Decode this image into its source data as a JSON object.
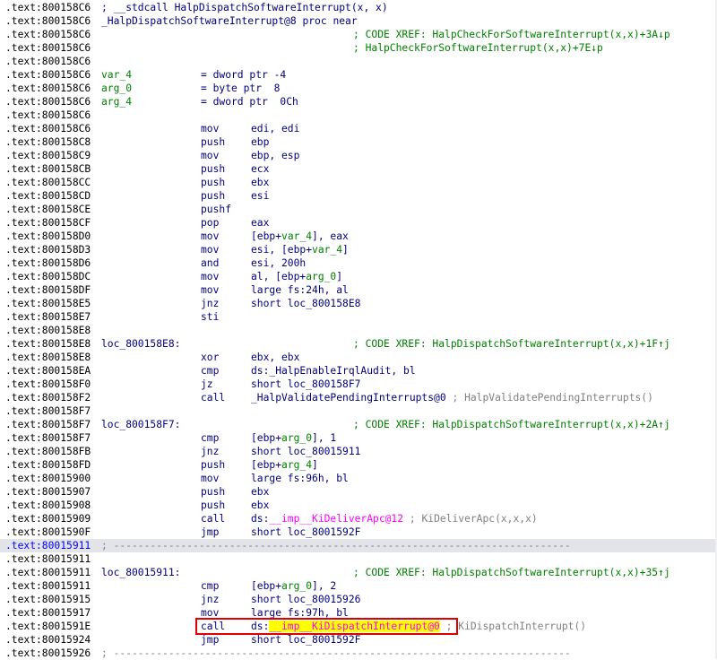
{
  "rows": [
    {
      "addr": ".text:800158C6",
      "hdr": "; __stdcall HalpDispatchSoftwareInterrupt(x, x)"
    },
    {
      "addr": ".text:800158C6",
      "hdr": "_HalpDispatchSoftwareInterrupt@8 proc near"
    },
    {
      "addr": ".text:800158C6",
      "xref": "; CODE XREF: HalpCheckForSoftwareInterrupt(x,x)+3A↓p"
    },
    {
      "addr": ".text:800158C6",
      "xref": "; HalpCheckForSoftwareInterrupt(x,x)+7E↓p"
    },
    {
      "addr": ".text:800158C6"
    },
    {
      "addr": ".text:800158C6",
      "var": "var_4",
      "def": "= dword ptr -4"
    },
    {
      "addr": ".text:800158C6",
      "var": "arg_0",
      "def": "= byte ptr  8"
    },
    {
      "addr": ".text:800158C6",
      "var": "arg_4",
      "def": "= dword ptr  0Ch"
    },
    {
      "addr": ".text:800158C6"
    },
    {
      "addr": ".text:800158C6",
      "mnem": "mov",
      "ops": "edi, edi"
    },
    {
      "addr": ".text:800158C8",
      "mnem": "push",
      "ops": "ebp"
    },
    {
      "addr": ".text:800158C9",
      "mnem": "mov",
      "ops": "ebp, esp"
    },
    {
      "addr": ".text:800158CB",
      "mnem": "push",
      "ops": "ecx"
    },
    {
      "addr": ".text:800158CC",
      "mnem": "push",
      "ops": "ebx"
    },
    {
      "addr": ".text:800158CD",
      "mnem": "push",
      "ops": "esi"
    },
    {
      "addr": ".text:800158CE",
      "mnem": "pushf"
    },
    {
      "addr": ".text:800158CF",
      "mnem": "pop",
      "ops": "eax"
    },
    {
      "addr": ".text:800158D0",
      "mnem": "mov",
      "ops_a": "[ebp+",
      "ops_v": "var_4",
      "ops_b": "], eax"
    },
    {
      "addr": ".text:800158D3",
      "mnem": "mov",
      "ops_a": "esi, [ebp+",
      "ops_v": "var_4",
      "ops_b": "]"
    },
    {
      "addr": ".text:800158D6",
      "mnem": "and",
      "ops": "esi, 200h"
    },
    {
      "addr": ".text:800158DC",
      "mnem": "mov",
      "ops_a": "al, [ebp+",
      "ops_v": "arg_0",
      "ops_b": "]"
    },
    {
      "addr": ".text:800158DF",
      "mnem": "mov",
      "ops": "large fs:24h, al"
    },
    {
      "addr": ".text:800158E5",
      "mnem": "jnz",
      "ops": "short loc_800158E8"
    },
    {
      "addr": ".text:800158E7",
      "mnem": "sti"
    },
    {
      "addr": ".text:800158E8"
    },
    {
      "addr": ".text:800158E8",
      "label": "loc_800158E8:",
      "xref": "; CODE XREF: HalpDispatchSoftwareInterrupt(x,x)+1F↑j"
    },
    {
      "addr": ".text:800158E8",
      "mnem": "xor",
      "ops": "ebx, ebx"
    },
    {
      "addr": ".text:800158EA",
      "mnem": "cmp",
      "ops": "ds:_HalpEnableIrqlAudit, bl"
    },
    {
      "addr": ".text:800158F0",
      "mnem": "jz",
      "ops": "short loc_800158F7"
    },
    {
      "addr": ".text:800158F2",
      "mnem": "call",
      "ops": "_HalpValidatePendingInterrupts@0",
      "cmt": "; HalpValidatePendingInterrupts()"
    },
    {
      "addr": ".text:800158F7"
    },
    {
      "addr": ".text:800158F7",
      "label": "loc_800158F7:",
      "xref": "; CODE XREF: HalpDispatchSoftwareInterrupt(x,x)+2A↑j"
    },
    {
      "addr": ".text:800158F7",
      "mnem": "cmp",
      "ops_a": "[ebp+",
      "ops_v": "arg_0",
      "ops_b": "], 1"
    },
    {
      "addr": ".text:800158FB",
      "mnem": "jnz",
      "ops": "short loc_80015911"
    },
    {
      "addr": ".text:800158FD",
      "mnem": "push",
      "ops_a": "[ebp+",
      "ops_v": "arg_4",
      "ops_b": "]"
    },
    {
      "addr": ".text:80015900",
      "mnem": "mov",
      "ops": "large fs:96h, bl"
    },
    {
      "addr": ".text:80015907",
      "mnem": "push",
      "ops": "ebx"
    },
    {
      "addr": ".text:80015908",
      "mnem": "push",
      "ops": "ebx"
    },
    {
      "addr": ".text:80015909",
      "mnem": "call",
      "ops_a": "ds:",
      "ops_i": "__imp__KiDeliverApc@12",
      "cmt": "; KiDeliverApc(x,x,x)"
    },
    {
      "addr": ".text:8001590F",
      "mnem": "jmp",
      "ops": "short loc_8001592F"
    },
    {
      "addr": ".text:80015911",
      "sep": "; ---------------------------------------------------------------------------",
      "selected": true
    },
    {
      "addr": ".text:80015911"
    },
    {
      "addr": ".text:80015911",
      "label": "loc_80015911:",
      "xref": "; CODE XREF: HalpDispatchSoftwareInterrupt(x,x)+35↑j"
    },
    {
      "addr": ".text:80015911",
      "mnem": "cmp",
      "ops_a": "[ebp+",
      "ops_v": "arg_0",
      "ops_b": "], 2"
    },
    {
      "addr": ".text:80015915",
      "mnem": "jnz",
      "ops": "short loc_80015926"
    },
    {
      "addr": ".text:80015917",
      "mnem": "mov",
      "ops": "large fs:97h, bl"
    },
    {
      "addr": ".text:8001591E",
      "mnem": "call",
      "ops_a": "ds:",
      "ops_i": "__imp__KiDispatchInterrupt@0",
      "cmt": "; KiDispatchInterrupt()",
      "highlight": true
    },
    {
      "addr": ".text:80015924",
      "mnem": "jmp",
      "ops": "short loc_8001592F"
    },
    {
      "addr": ".text:80015926",
      "sep": "; ---------------------------------------------------------------------------"
    }
  ],
  "colors": {
    "address": "#000000",
    "code": "#000080",
    "variable": "#008000",
    "comment_xref": "#008000",
    "comment": "#808080",
    "import": "#ff00ff",
    "highlight": "#ffff00",
    "box": "#e00000",
    "selected_row": "#e2e4ea"
  }
}
